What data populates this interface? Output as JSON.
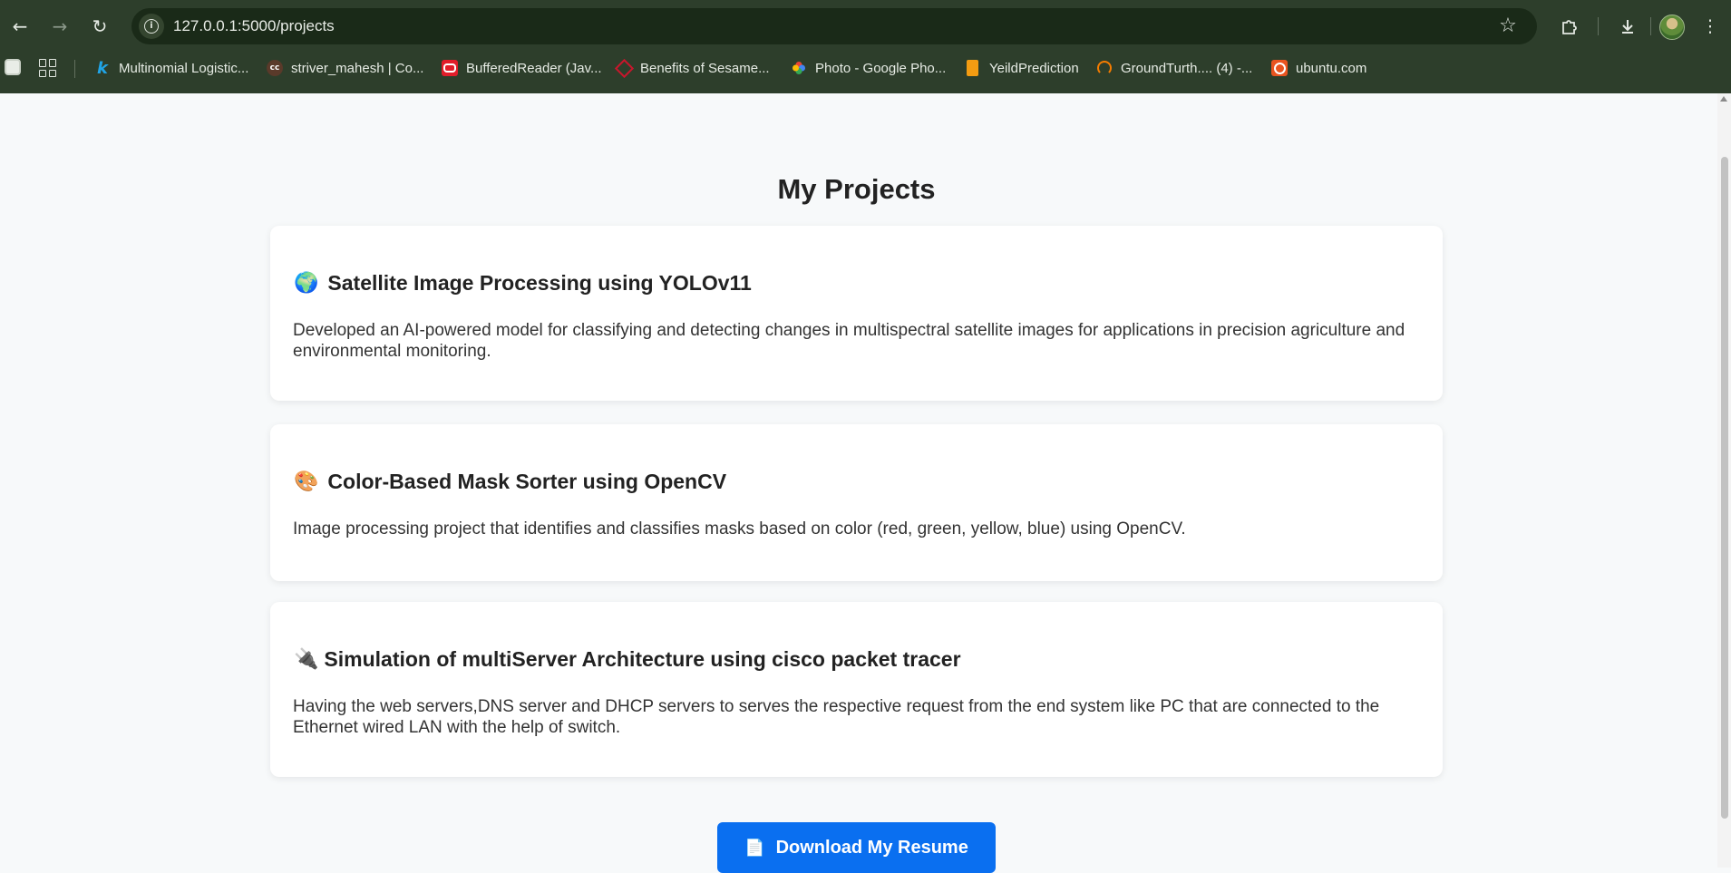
{
  "browser": {
    "url": "127.0.0.1:5000/projects",
    "icons": {
      "back": "back-arrow-icon",
      "forward": "forward-arrow-icon",
      "reload": "reload-icon",
      "site_info": "info-icon",
      "bookmark_star": "star-icon",
      "extensions": "puzzle-icon",
      "downloads": "download-icon",
      "menu": "kebab-menu-icon"
    },
    "bookmarks": [
      {
        "label": "Multinomial Logistic...",
        "icon": "k",
        "color": "#20a4e6"
      },
      {
        "label": "striver_mahesh | Co...",
        "icon": "cc",
        "color": "#5a3a2a"
      },
      {
        "label": "BufferedReader (Jav...",
        "icon": "oracle",
        "color": "#e11d2a"
      },
      {
        "label": "Benefits of Sesame...",
        "icon": "diamond",
        "color": "#c8162c"
      },
      {
        "label": "Photo - Google Pho...",
        "icon": "pinwheel",
        "color": "#f4b400"
      },
      {
        "label": "YeildPrediction",
        "icon": "book",
        "color": "#f39c12"
      },
      {
        "label": "GroundTurth.... (4) -...",
        "icon": "arc",
        "color": "#f57c00"
      },
      {
        "label": "ubuntu.com",
        "icon": "ubuntu",
        "color": "#e95420"
      }
    ]
  },
  "page": {
    "title": "My Projects",
    "projects": [
      {
        "emoji": "🌍",
        "title": "Satellite Image Processing using YOLOv11",
        "description": "Developed an AI-powered model for classifying and detecting changes in multispectral satellite images for applications in precision agriculture and environmental monitoring."
      },
      {
        "emoji": "🎨",
        "title": "Color-Based Mask Sorter using OpenCV",
        "description": "Image processing project that identifies and classifies masks based on color (red, green, yellow, blue) using OpenCV."
      },
      {
        "emoji": "🔌",
        "title": "Simulation of multiServer Architecture using cisco packet tracer",
        "description": "Having the web servers,DNS server and DHCP servers to serves the respective request from the end system like PC that are connected to the Ethernet wired LAN with the help of switch."
      }
    ],
    "resume_button": {
      "icon": "📄",
      "label": "Download My Resume"
    }
  },
  "colors": {
    "chrome": "#2d3e2b",
    "omnibox": "#1a2a18",
    "page_bg": "#f7f9fa",
    "button": "#0a6ff0"
  }
}
